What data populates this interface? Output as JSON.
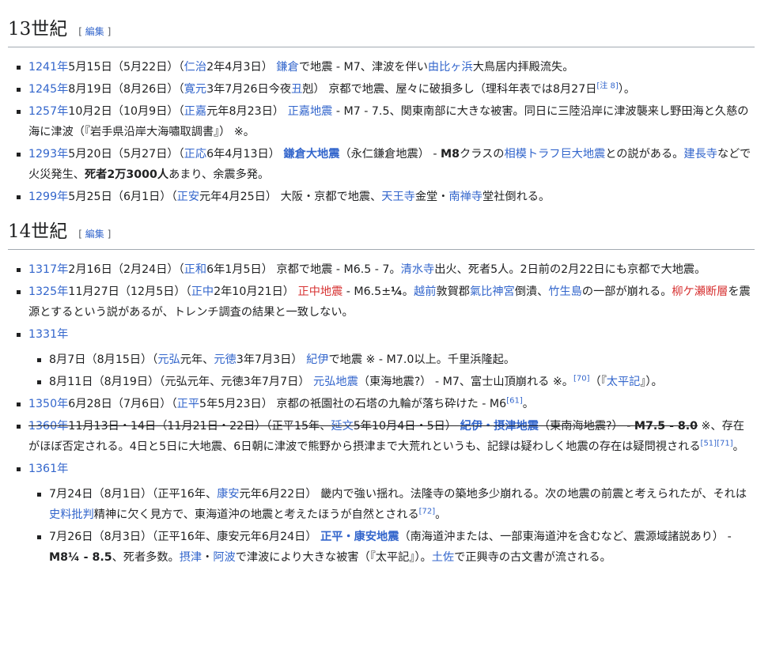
{
  "edit_label": "編集",
  "sections": [
    {
      "title": "13世紀",
      "items": [
        {
          "y": "1241年",
          "d": "5月15日（5月22日）（",
          "era": "仁治",
          "d2": "2年4月3日）",
          "place": "鎌倉",
          "t1": "で地震 - M7、津波を伴い",
          "link2": "由比ヶ浜",
          "t2": "大鳥居内拝殿流失。"
        },
        {
          "y": "1245年",
          "d": "8月19日（8月26日）（",
          "era": "寛元",
          "d2": "3年7月26日今夜",
          "link": "丑",
          "t1": "剋） 京都で地震、屋々に破損多し（理科年表では8月27日",
          "ref": "[注 8]",
          "t2": "）。"
        },
        {
          "y": "1257年",
          "d": "10月2日（10月9日）（",
          "era": "正嘉",
          "d2": "元年8月23日） ",
          "quake": "正嘉地震",
          "t1": " - M7 - 7.5、関東南部に大きな被害。同日に三陸沿岸に津波襲来し野田海と久慈の海に津波（『岩手県沿岸大海嘯取調書』） ※。"
        },
        {
          "y": "1293年",
          "d": "5月20日（5月27日）（",
          "era": "正応",
          "d2": "6年4月13日） ",
          "quake": "鎌倉大地震",
          "t1": "（永仁鎌倉地震） - ",
          "mag": "M8",
          "t2": "クラスの",
          "link2": "相模トラフ巨大地震",
          "t3": "との説がある。",
          "link3": "建長寺",
          "t4": "などで火災発生、",
          "bold": "死者2万3000人",
          "t5": "あまり、余震多発。"
        },
        {
          "y": "1299年",
          "d": "5月25日（6月1日）（",
          "era": "正安",
          "d2": "元年4月25日） 大阪・京都で地震、",
          "link2": "天王寺",
          "t1": "金堂・",
          "link3": "南禅寺",
          "t2": "堂社倒れる。"
        }
      ]
    },
    {
      "title": "14世紀",
      "items": [
        {
          "y": "1317年",
          "d": "2月16日（2月24日）（",
          "era": "正和",
          "d2": "6年1月5日） 京都で地震 - M6.5 - 7。",
          "link2": "清水寺",
          "t1": "出火、死者5人。2日前の2月22日にも京都で大地震。"
        },
        {
          "y": "1325年",
          "d": "11月27日（12月5日）（",
          "era": "正中",
          "d2": "2年10月21日） ",
          "quake": "正中地震",
          "t1": " - M6.5±",
          "frac": "¼",
          "t2": "。",
          "link2": "越前",
          "t3": "敦賀郡",
          "link3": "氣比神宮",
          "t4": "倒潰、",
          "link4": "竹生島",
          "t5": "の一部が崩れる。",
          "fault": "柳ケ瀬断層",
          "t6": "を震源とするという説があるが、トレンチ調査の結果と一致しない。"
        },
        {
          "y": "1331年",
          "sub": [
            {
              "d": "8月7日（8月15日）（",
              "era": "元弘",
              "d2": "元年、",
              "era2": "元徳",
              "d3": "3年7月3日） ",
              "link2": "紀伊",
              "t1": "で地震 ※ - M7.0以上。千里浜隆起。"
            },
            {
              "d": "8月11日（8月19日）（元弘元年、元徳3年7月7日） ",
              "quake": "元弘地震",
              "t1": "（東海地震?） - M7、富士山頂崩れる ※。",
              "ref": "[70]",
              "t2": "（『",
              "link2": "太平記",
              "t3": "』）。"
            }
          ]
        },
        {
          "y": "1350年",
          "d": "6月28日（7月6日）（",
          "era": "正平",
          "d2": "5年5月23日） 京都の祇園社の石塔の九輪が落ち砕けた - M6",
          "ref": "[61]",
          "t1": "。"
        },
        {
          "y": "1360年",
          "strike1": "11月13日・14日（11月21日・22日）（正平15年、",
          "era": "延文",
          "strike2": "5年10月4日・5日） ",
          "quake": "紀伊・摂津地震",
          "strike3": "（東南海地震?） - ",
          "mag": "M7.5 - 8.0",
          "t1": " ※、存在がほぼ否定される。4日と5日に大地震、6日朝に津波で熊野から摂津まで大荒れというも、記録は疑わしく地震の存在は疑問視される",
          "ref": "[51][71]",
          "t2": "。"
        },
        {
          "y": "1361年",
          "sub": [
            {
              "d": "7月24日（8月1日）（正平16年、",
              "era": "康安",
              "d2": "元年6月22日） 畿内で強い揺れ。法隆寺の築地多少崩れる。次の地震の前震と考えられたが、それは",
              "link2": "史料批判",
              "t1": "精神に欠く見方で、東海道沖の地震と考えたほうが自然とされる",
              "ref": "[72]",
              "t2": "。"
            },
            {
              "d": "7月26日（8月3日）（正平16年、康安元年6月24日） ",
              "quake": "正平・康安地震",
              "t1": "（南海道沖または、一部東海道沖を含むなど、震源域諸説あり） - ",
              "mag": "M8¼ - 8.5",
              "t2": "、死者多数。",
              "link2": "摂津",
              "t3": "・",
              "link3": "阿波",
              "t4": "で津波により大きな被害（『太平記』）。",
              "link4": "土佐",
              "t5": "で正興寺の古文書が流される。"
            }
          ]
        }
      ]
    }
  ]
}
